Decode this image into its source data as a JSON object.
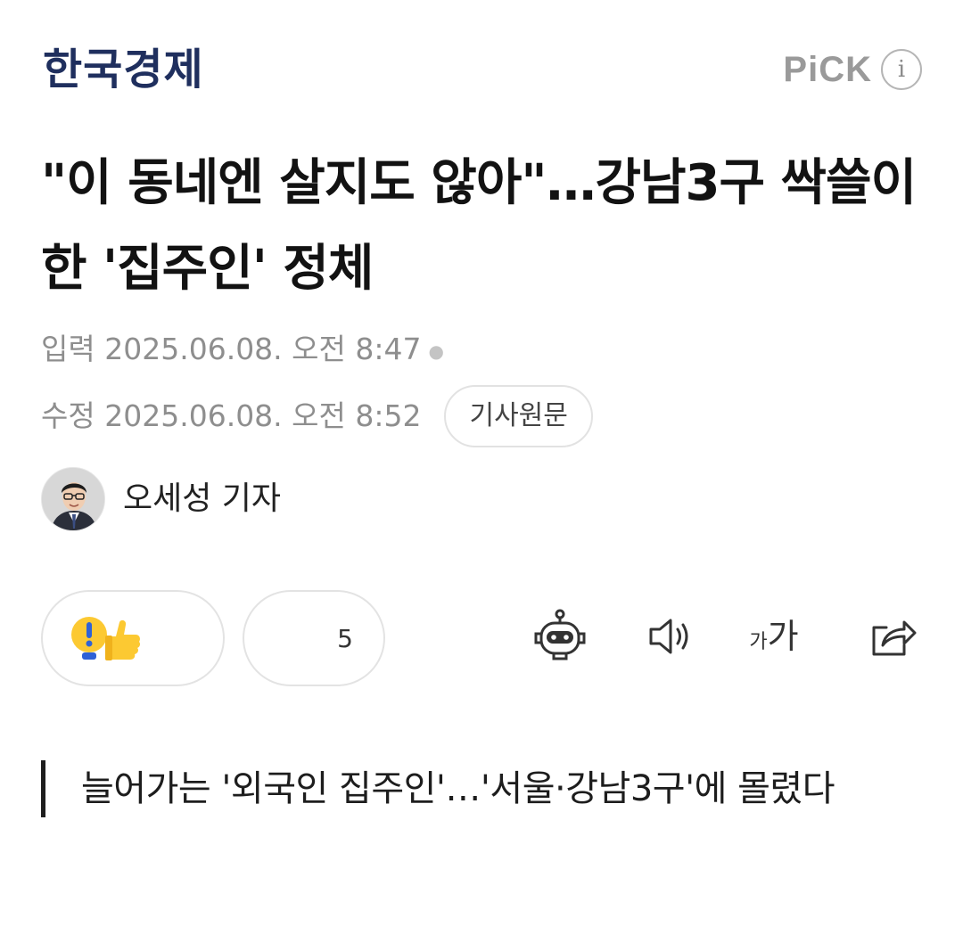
{
  "header": {
    "press_name": "한국경제",
    "pick_label": "PiCK",
    "info_label": "i"
  },
  "article": {
    "headline": "\"이 동네엔 살지도 않아\"…강남3구 싹쓸이한 '집주인' 정체",
    "input_label": "입력",
    "input_datetime": "2025.06.08. 오전 8:47",
    "modified_label": "수정",
    "modified_datetime": "2025.06.08. 오전 8:52",
    "original_article_button": "기사원문",
    "reporter_name": "오세성 기자",
    "subtitle": "늘어가는 '외국인 집주인'…'서울·강남3구'에 몰렸다"
  },
  "reactions": {
    "recommend_count": "5"
  },
  "toolbar": {
    "summary_icon": "robot-icon",
    "tts_icon": "speaker-icon",
    "font_size_label": "가가",
    "share_icon": "share-icon"
  },
  "colors": {
    "press_logo": "#1f2f5e",
    "muted_text": "#8e8e8e",
    "quote_bar": "#1e1e1e"
  }
}
